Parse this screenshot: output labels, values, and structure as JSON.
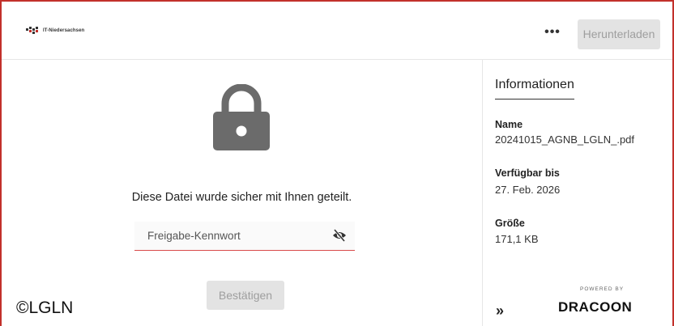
{
  "header": {
    "logo_text": "IT-Niedersachsen",
    "more_label": "•••",
    "download_label": "Herunterladen"
  },
  "main": {
    "shared_message": "Diese Datei wurde sicher mit Ihnen geteilt.",
    "password_placeholder": "Freigabe-Kennwort",
    "confirm_label": "Bestätigen",
    "copyright": "©LGLN"
  },
  "sidebar": {
    "title": "Informationen",
    "name_label": "Name",
    "name_value": "20241015_AGNB_LGLN_.pdf",
    "available_label": "Verfügbar bis",
    "available_value": "27. Feb. 2026",
    "size_label": "Größe",
    "size_value": "171,1 KB",
    "collapse_label": "»",
    "powered_by": "POWERED BY",
    "brand": "DRACOON"
  },
  "colors": {
    "accent_border": "#c2302b",
    "input_underline": "#d94a4a",
    "lock_gray": "#6b6b6b",
    "disabled_button": "#e3e3e3"
  },
  "icons": [
    "lock-icon",
    "eye-off-icon",
    "more-icon",
    "logo-icon"
  ]
}
